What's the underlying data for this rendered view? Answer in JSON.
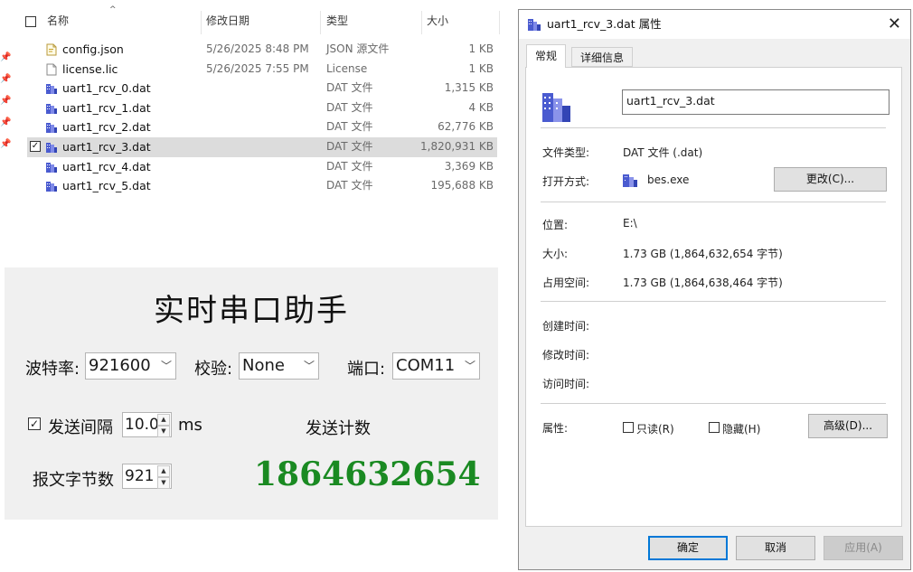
{
  "explorer": {
    "columns": {
      "name": "名称",
      "modified": "修改日期",
      "type": "类型",
      "size": "大小"
    },
    "files": [
      {
        "name": "config.json",
        "modified": "5/26/2025 8:48 PM",
        "type": "JSON 源文件",
        "size": "1 KB",
        "icon": "json-file-icon",
        "selected": false
      },
      {
        "name": "license.lic",
        "modified": "5/26/2025 7:55 PM",
        "type": "License",
        "size": "1 KB",
        "icon": "document-icon",
        "selected": false
      },
      {
        "name": "uart1_rcv_0.dat",
        "modified": "",
        "type": "DAT 文件",
        "size": "1,315 KB",
        "icon": "dat-file-icon",
        "selected": false
      },
      {
        "name": "uart1_rcv_1.dat",
        "modified": "",
        "type": "DAT 文件",
        "size": "4 KB",
        "icon": "dat-file-icon",
        "selected": false
      },
      {
        "name": "uart1_rcv_2.dat",
        "modified": "",
        "type": "DAT 文件",
        "size": "62,776 KB",
        "icon": "dat-file-icon",
        "selected": false
      },
      {
        "name": "uart1_rcv_3.dat",
        "modified": "",
        "type": "DAT 文件",
        "size": "1,820,931 KB",
        "icon": "dat-file-icon",
        "selected": true
      },
      {
        "name": "uart1_rcv_4.dat",
        "modified": "",
        "type": "DAT 文件",
        "size": "3,369 KB",
        "icon": "dat-file-icon",
        "selected": false
      },
      {
        "name": "uart1_rcv_5.dat",
        "modified": "",
        "type": "DAT 文件",
        "size": "195,688 KB",
        "icon": "dat-file-icon",
        "selected": false
      }
    ]
  },
  "serial": {
    "title": "实时串口助手",
    "baud_label": "波特率:",
    "baud_value": "921600",
    "parity_label": "校验:",
    "parity_value": "None",
    "port_label": "端口:",
    "port_value": "COM11",
    "send_interval_label": "发送间隔",
    "send_interval_value": "10.0",
    "send_interval_unit": "ms",
    "send_interval_checked": true,
    "send_count_label": "发送计数",
    "packet_bytes_label": "报文字节数",
    "packet_bytes_value": "921",
    "send_count_value": "1864632654"
  },
  "dialog": {
    "title": "uart1_rcv_3.dat 属性",
    "tabs": [
      "常规",
      "详细信息"
    ],
    "filename": "uart1_rcv_3.dat",
    "file_type_label": "文件类型:",
    "file_type_value": "DAT 文件 (.dat)",
    "open_with_label": "打开方式:",
    "open_with_value": "bes.exe",
    "change_button": "更改(C)...",
    "location_label": "位置:",
    "location_value": "E:\\",
    "size_label": "大小:",
    "size_value": "1.73 GB (1,864,632,654 字节)",
    "disk_size_label": "占用空间:",
    "disk_size_value": "1.73 GB (1,864,638,464 字节)",
    "created_label": "创建时间:",
    "modified_label": "修改时间:",
    "accessed_label": "访问时间:",
    "attributes_label": "属性:",
    "readonly_label": "只读(R)",
    "hidden_label": "隐藏(H)",
    "advanced_button": "高级(D)...",
    "ok_button": "确定",
    "cancel_button": "取消",
    "apply_button": "应用(A)",
    "colors": {
      "accent": "#0078d7"
    }
  }
}
